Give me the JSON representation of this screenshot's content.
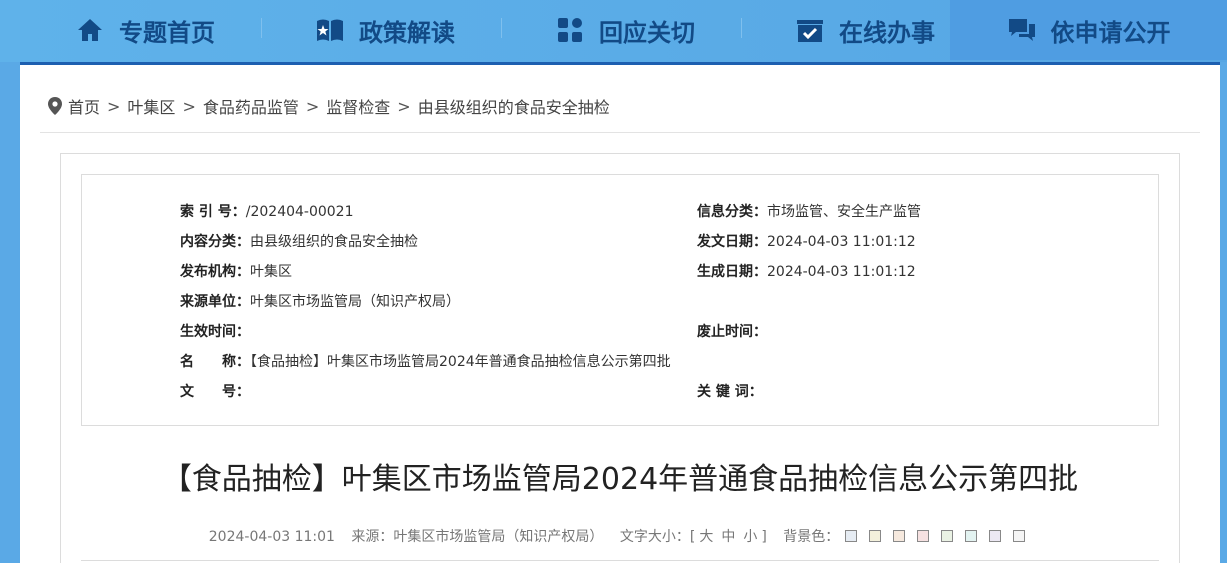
{
  "nav": {
    "items": [
      {
        "label": "专题首页",
        "icon": "home-icon"
      },
      {
        "label": "政策解读",
        "icon": "book-icon"
      },
      {
        "label": "回应关切",
        "icon": "grid-icon"
      },
      {
        "label": "在线办事",
        "icon": "inbox-check-icon"
      },
      {
        "label": "依申请公开",
        "icon": "chat-icon"
      }
    ]
  },
  "breadcrumb": {
    "icon": "location-pin-icon",
    "items": [
      "首页",
      "叶集区",
      "食品药品监管",
      "监督检查",
      "由县级组织的食品安全抽检"
    ],
    "separator": ">"
  },
  "meta": {
    "index_label": "索 引 号：",
    "index_value": "/202404-00021",
    "info_cat_label": "信息分类：",
    "info_cat_value": "市场监管、安全生产监管",
    "content_cat_label": "内容分类：",
    "content_cat_value": "由县级组织的食品安全抽检",
    "pub_date_label": "发文日期：",
    "pub_date_value": "2024-04-03 11:01:12",
    "org_label": "发布机构：",
    "org_value": "叶集区",
    "gen_date_label": "生成日期：",
    "gen_date_value": "2024-04-03 11:01:12",
    "source_label": "来源单位：",
    "source_value": "叶集区市场监管局（知识产权局）",
    "effective_label": "生效时间：",
    "effective_value": "",
    "expire_label": "废止时间：",
    "expire_value": "",
    "name_label": "名　　称：",
    "name_value": "【食品抽检】叶集区市场监管局2024年普通食品抽检信息公示第四批",
    "docno_label": "文　　号：",
    "docno_value": "",
    "keywords_label": "关 键 词：",
    "keywords_value": ""
  },
  "article": {
    "title": "【食品抽检】叶集区市场监管局2024年普通食品抽检信息公示第四批",
    "date": "2024-04-03 11:01",
    "source": "来源：叶集区市场监管局（知识产权局）",
    "font_size_label": "文字大小：[",
    "font_size_end": "]",
    "font_large": "大",
    "font_medium": "中",
    "font_small": "小",
    "bg_label": "背景色：",
    "bg_colors": [
      "#e6ecf3",
      "#f4f1dc",
      "#f6e9de",
      "#f6e1e1",
      "#eaf2e4",
      "#e3f3f1",
      "#ece8f3",
      "#f5f5f5"
    ]
  },
  "colors": {
    "nav_text": "#124a86",
    "accent_border": "#1d5fb0"
  }
}
